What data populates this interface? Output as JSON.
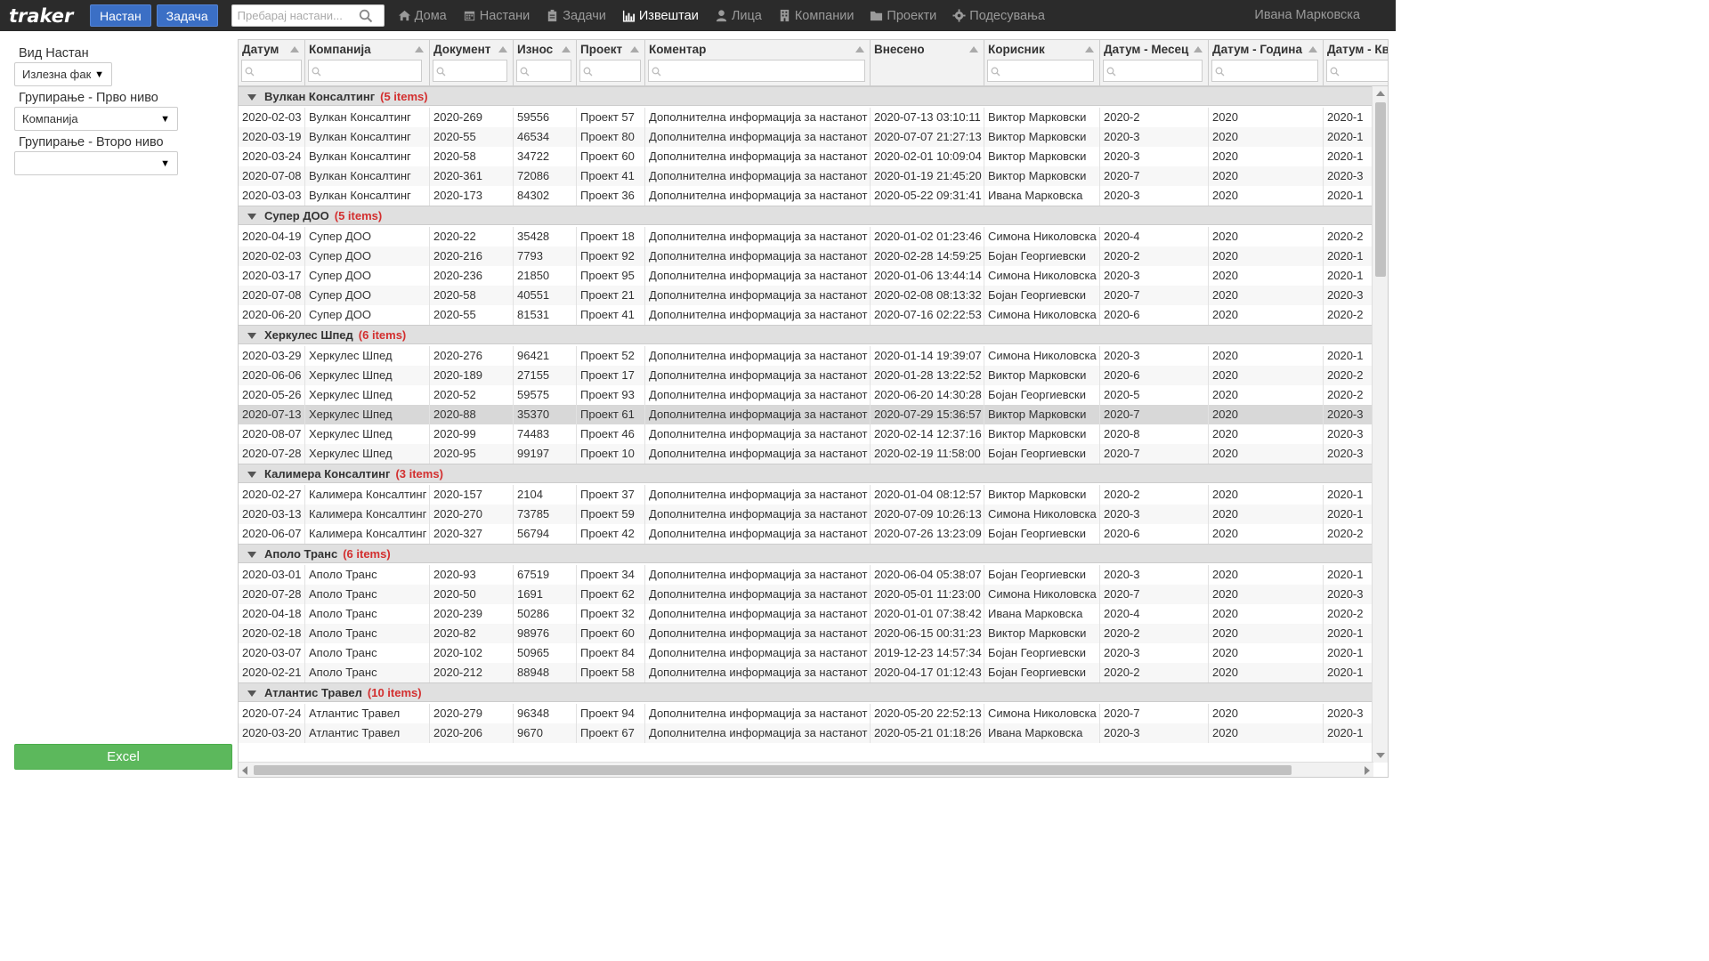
{
  "nav": {
    "brand": "traker",
    "btn_primary": "Настан",
    "btn_secondary": "Задача",
    "search_placeholder": "Пребарај настани...",
    "links": [
      {
        "label": "Дома",
        "icon": "home-icon"
      },
      {
        "label": "Настани",
        "icon": "calendar-icon"
      },
      {
        "label": "Задачи",
        "icon": "clipboard-icon"
      },
      {
        "label": "Извештаи",
        "icon": "bar-chart-icon",
        "active": true
      },
      {
        "label": "Лица",
        "icon": "user-icon"
      },
      {
        "label": "Компании",
        "icon": "building-icon"
      },
      {
        "label": "Проекти",
        "icon": "folder-icon"
      },
      {
        "label": "Подесувања",
        "icon": "gear-icon"
      }
    ],
    "user": "Ивана Марковска"
  },
  "sidebar": {
    "event_type_label": "Вид Настан",
    "event_type_value": "Излезна фак",
    "group1_label": "Групирање - Прво ниво",
    "group1_value": "Компанија",
    "group2_label": "Групирање - Второ ниво",
    "group2_value": "",
    "excel_label": "Excel"
  },
  "columns": [
    "Датум",
    "Компанија",
    "Документ",
    "Износ",
    "Проект",
    "Коментар",
    "Внесено",
    "Корисник",
    "Датум - Месец",
    "Датум - Година",
    "Датум - Кв"
  ],
  "groups": [
    {
      "name": "Вулкан Консалтинг",
      "count": "(5 items)",
      "rows": [
        [
          "2020-02-03",
          "Вулкан Консалтинг",
          "2020-269",
          "59556",
          "Проект 57",
          "Дополнителна информација за настанот",
          "2020-07-13 03:10:11",
          "Виктор Марковски",
          "2020-2",
          "2020",
          "2020-1"
        ],
        [
          "2020-03-19",
          "Вулкан Консалтинг",
          "2020-55",
          "46534",
          "Проект 80",
          "Дополнителна информација за настанот",
          "2020-07-07 21:27:13",
          "Виктор Марковски",
          "2020-3",
          "2020",
          "2020-1"
        ],
        [
          "2020-03-24",
          "Вулкан Консалтинг",
          "2020-58",
          "34722",
          "Проект 60",
          "Дополнителна информација за настанот",
          "2020-02-01 10:09:04",
          "Виктор Марковски",
          "2020-3",
          "2020",
          "2020-1"
        ],
        [
          "2020-07-08",
          "Вулкан Консалтинг",
          "2020-361",
          "72086",
          "Проект 41",
          "Дополнителна информација за настанот",
          "2020-01-19 21:45:20",
          "Виктор Марковски",
          "2020-7",
          "2020",
          "2020-3"
        ],
        [
          "2020-03-03",
          "Вулкан Консалтинг",
          "2020-173",
          "84302",
          "Проект 36",
          "Дополнителна информација за настанот",
          "2020-05-22 09:31:41",
          "Ивана Марковска",
          "2020-3",
          "2020",
          "2020-1"
        ]
      ]
    },
    {
      "name": "Супер ДОО",
      "count": "(5 items)",
      "rows": [
        [
          "2020-04-19",
          "Супер ДОО",
          "2020-22",
          "35428",
          "Проект 18",
          "Дополнителна информација за настанот",
          "2020-01-02 01:23:46",
          "Симона Николовска",
          "2020-4",
          "2020",
          "2020-2"
        ],
        [
          "2020-02-03",
          "Супер ДОО",
          "2020-216",
          "7793",
          "Проект 92",
          "Дополнителна информација за настанот",
          "2020-02-28 14:59:25",
          "Бојан Георгиевски",
          "2020-2",
          "2020",
          "2020-1"
        ],
        [
          "2020-03-17",
          "Супер ДОО",
          "2020-236",
          "21850",
          "Проект 95",
          "Дополнителна информација за настанот",
          "2020-01-06 13:44:14",
          "Симона Николовска",
          "2020-3",
          "2020",
          "2020-1"
        ],
        [
          "2020-07-08",
          "Супер ДОО",
          "2020-58",
          "40551",
          "Проект 21",
          "Дополнителна информација за настанот",
          "2020-02-08 08:13:32",
          "Бојан Георгиевски",
          "2020-7",
          "2020",
          "2020-3"
        ],
        [
          "2020-06-20",
          "Супер ДОО",
          "2020-55",
          "81531",
          "Проект 41",
          "Дополнителна информација за настанот",
          "2020-07-16 02:22:53",
          "Симона Николовска",
          "2020-6",
          "2020",
          "2020-2"
        ]
      ]
    },
    {
      "name": "Херкулес Шпед",
      "count": "(6 items)",
      "rows": [
        [
          "2020-03-29",
          "Херкулес Шпед",
          "2020-276",
          "96421",
          "Проект 52",
          "Дополнителна информација за настанот",
          "2020-01-14 19:39:07",
          "Симона Николовска",
          "2020-3",
          "2020",
          "2020-1"
        ],
        [
          "2020-06-06",
          "Херкулес Шпед",
          "2020-189",
          "27155",
          "Проект 17",
          "Дополнителна информација за настанот",
          "2020-01-28 13:22:52",
          "Виктор Марковски",
          "2020-6",
          "2020",
          "2020-2"
        ],
        [
          "2020-05-26",
          "Херкулес Шпед",
          "2020-52",
          "59575",
          "Проект 93",
          "Дополнителна информација за настанот",
          "2020-06-20 14:30:28",
          "Бојан Георгиевски",
          "2020-5",
          "2020",
          "2020-2"
        ],
        [
          "2020-07-13",
          "Херкулес Шпед",
          "2020-88",
          "35370",
          "Проект 61",
          "Дополнителна информација за настанот",
          "2020-07-29 15:36:57",
          "Виктор Марковски",
          "2020-7",
          "2020",
          "2020-3"
        ],
        [
          "2020-08-07",
          "Херкулес Шпед",
          "2020-99",
          "74483",
          "Проект 46",
          "Дополнителна информација за настанот",
          "2020-02-14 12:37:16",
          "Виктор Марковски",
          "2020-8",
          "2020",
          "2020-3"
        ],
        [
          "2020-07-28",
          "Херкулес Шпед",
          "2020-95",
          "99197",
          "Проект 10",
          "Дополнителна информација за настанот",
          "2020-02-19 11:58:00",
          "Бојан Георгиевски",
          "2020-7",
          "2020",
          "2020-3"
        ]
      ]
    },
    {
      "name": "Калимера Консалтинг",
      "count": "(3 items)",
      "rows": [
        [
          "2020-02-27",
          "Калимера Консалтинг",
          "2020-157",
          "2104",
          "Проект 37",
          "Дополнителна информација за настанот",
          "2020-01-04 08:12:57",
          "Виктор Марковски",
          "2020-2",
          "2020",
          "2020-1"
        ],
        [
          "2020-03-13",
          "Калимера Консалтинг",
          "2020-270",
          "73785",
          "Проект 59",
          "Дополнителна информација за настанот",
          "2020-07-09 10:26:13",
          "Симона Николовска",
          "2020-3",
          "2020",
          "2020-1"
        ],
        [
          "2020-06-07",
          "Калимера Консалтинг",
          "2020-327",
          "56794",
          "Проект 42",
          "Дополнителна информација за настанот",
          "2020-07-26 13:23:09",
          "Бојан Георгиевски",
          "2020-6",
          "2020",
          "2020-2"
        ]
      ]
    },
    {
      "name": "Аполо Транс",
      "count": "(6 items)",
      "rows": [
        [
          "2020-03-01",
          "Аполо Транс",
          "2020-93",
          "67519",
          "Проект 34",
          "Дополнителна информација за настанот",
          "2020-06-04 05:38:07",
          "Бојан Георгиевски",
          "2020-3",
          "2020",
          "2020-1"
        ],
        [
          "2020-07-28",
          "Аполо Транс",
          "2020-50",
          "1691",
          "Проект 62",
          "Дополнителна информација за настанот",
          "2020-05-01 11:23:00",
          "Симона Николовска",
          "2020-7",
          "2020",
          "2020-3"
        ],
        [
          "2020-04-18",
          "Аполо Транс",
          "2020-239",
          "50286",
          "Проект 32",
          "Дополнителна информација за настанот",
          "2020-01-01 07:38:42",
          "Ивана Марковска",
          "2020-4",
          "2020",
          "2020-2"
        ],
        [
          "2020-02-18",
          "Аполо Транс",
          "2020-82",
          "98976",
          "Проект 60",
          "Дополнителна информација за настанот",
          "2020-06-15 00:31:23",
          "Виктор Марковски",
          "2020-2",
          "2020",
          "2020-1"
        ],
        [
          "2020-03-07",
          "Аполо Транс",
          "2020-102",
          "50965",
          "Проект 84",
          "Дополнителна информација за настанот",
          "2019-12-23 14:57:34",
          "Бојан Георгиевски",
          "2020-3",
          "2020",
          "2020-1"
        ],
        [
          "2020-02-21",
          "Аполо Транс",
          "2020-212",
          "88948",
          "Проект 58",
          "Дополнителна информација за настанот",
          "2020-04-17 01:12:43",
          "Бојан Георгиевски",
          "2020-2",
          "2020",
          "2020-1"
        ]
      ]
    },
    {
      "name": "Атлантис Травел",
      "count": "(10 items)",
      "rows": [
        [
          "2020-07-24",
          "Атлантис Травел",
          "2020-279",
          "96348",
          "Проект 94",
          "Дополнителна информација за настанот",
          "2020-05-20 22:52:13",
          "Симона Николовска",
          "2020-7",
          "2020",
          "2020-3"
        ],
        [
          "2020-03-20",
          "Атлантис Травел",
          "2020-206",
          "9670",
          "Проект 67",
          "Дополнителна информација за настанот",
          "2020-05-21 01:18:26",
          "Ивана Марковска",
          "2020-3",
          "2020",
          "2020-1"
        ]
      ]
    }
  ],
  "selected_row": "2020-88",
  "colors": {
    "navbar": "#2b2b2b",
    "primary_btn": "#3b6fc5",
    "excel": "#5cb85c",
    "group_count": "#d32f2f"
  }
}
